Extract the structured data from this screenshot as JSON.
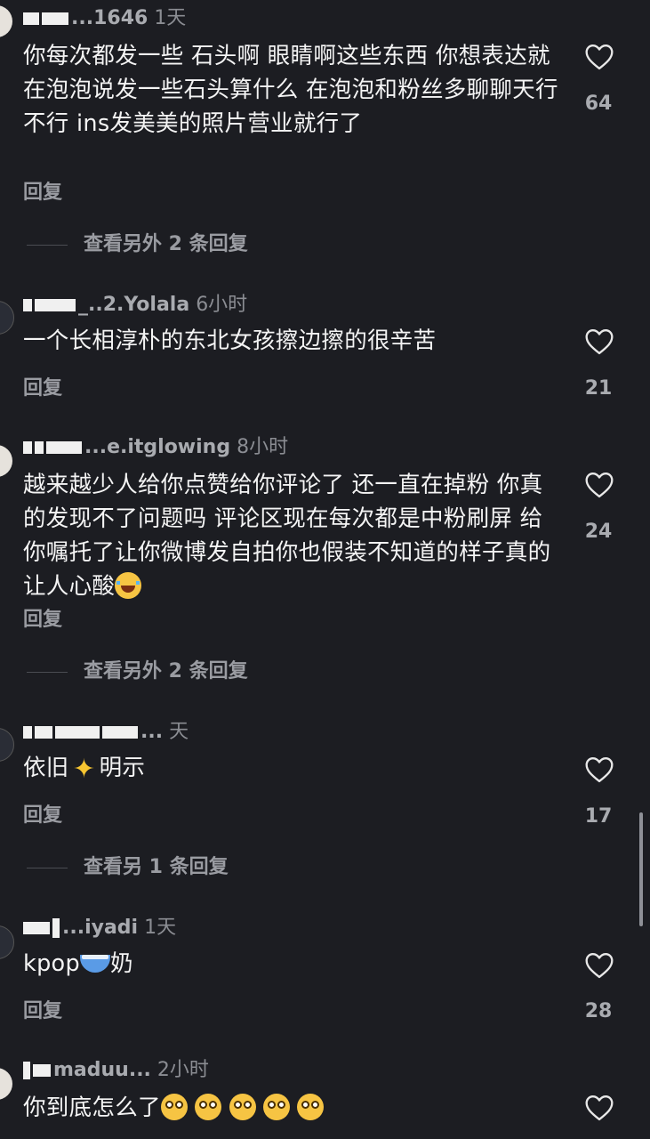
{
  "comments": [
    {
      "username": "...1646",
      "time": "1天",
      "text": "你每次都发一些 石头啊 眼睛啊这些东西 你想表达就在泡泡说发一些石头算什么  在泡泡和粉丝多聊聊天行不行 ins发美美的照片营业就行了",
      "reply_label": "回复",
      "view_more": "查看另外 2 条回复",
      "likes": "64"
    },
    {
      "username": "_..2.Yolala",
      "time": "6小时",
      "text": "一个长相淳朴的东北女孩擦边擦的很辛苦",
      "reply_label": "回复",
      "likes": "21"
    },
    {
      "username": "...e.itglowing",
      "time": "8小时",
      "text": "越来越少人给你点赞给你评论了 还一直在掉粉 你真的发现不了问题吗 评论区现在每次都是中粉刷屏 给你嘱托了让你微博发自拍你也假装不知道的样子真的让人心酸",
      "reply_label": "回复",
      "view_more": "查看另外 2 条回复",
      "likes": "24"
    },
    {
      "username": "...",
      "time": "天",
      "text_a": "依旧",
      "text_b": "明示",
      "reply_label": "回复",
      "view_more": "查看另 1 条回复",
      "likes": "17"
    },
    {
      "username": "...iyadi",
      "time": "1天",
      "text_a": "kpop",
      "text_b": "奶",
      "reply_label": "回复",
      "likes": "28"
    },
    {
      "username": "maduu...",
      "time": "2小时",
      "text": "你到底怎么了",
      "likes": ""
    }
  ],
  "icons": {
    "like": "heart-outline-icon",
    "emoji_laugh": "tears-of-joy-emoji",
    "emoji_star": "glowing-star-emoji",
    "emoji_bowl": "milk-bowl-emoji",
    "emoji_flushed": "flushed-face-emoji"
  },
  "colors": {
    "background": "#1c1d22",
    "text": "#f4f4f4",
    "muted": "#9a9ca2"
  }
}
